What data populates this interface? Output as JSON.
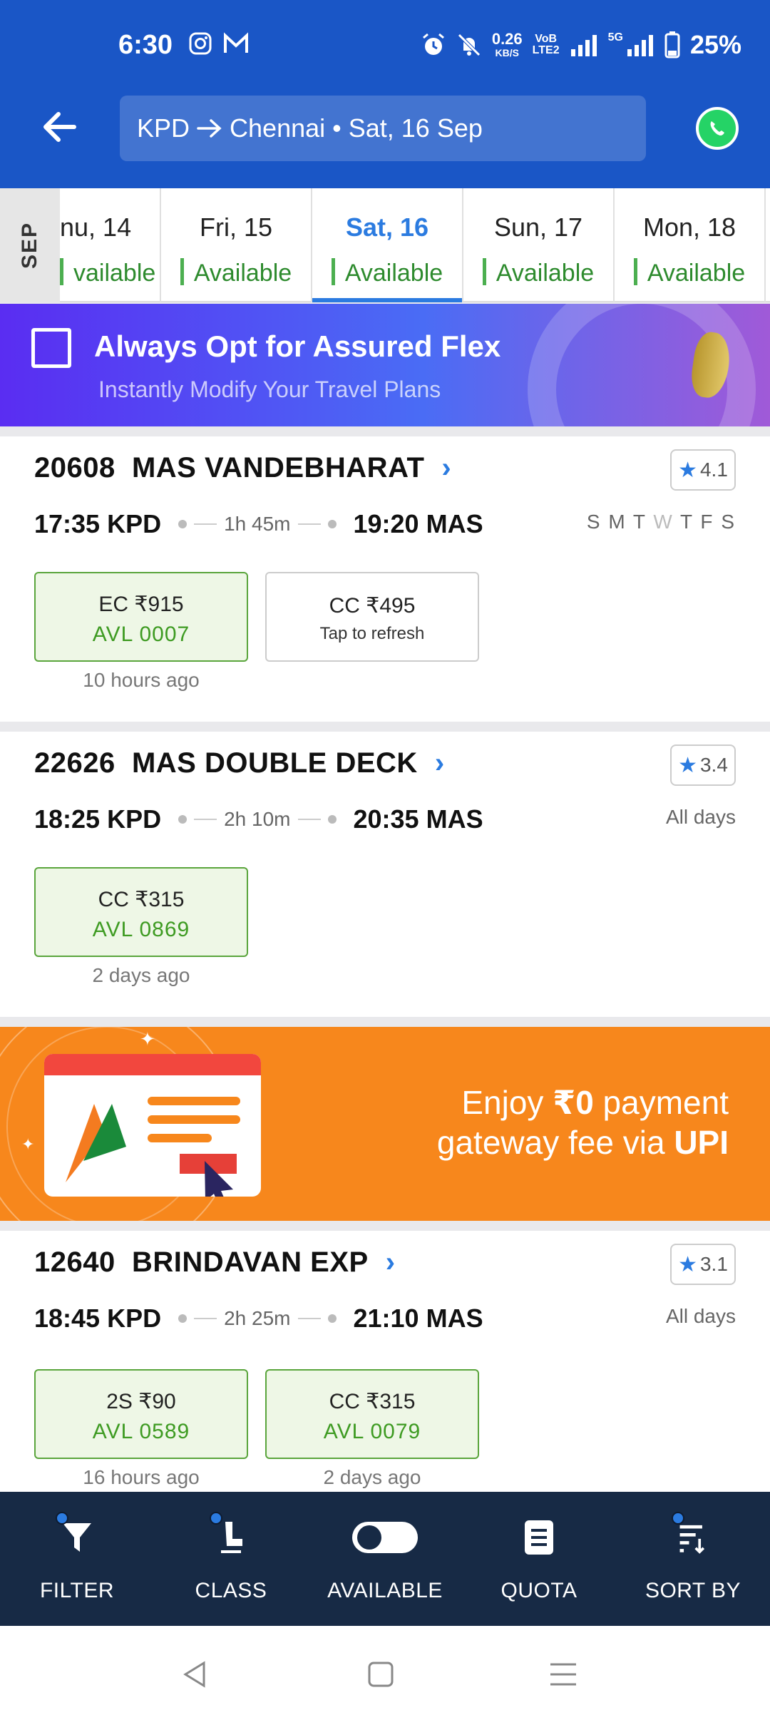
{
  "status": {
    "time": "6:30",
    "net_speed": "0.26",
    "net_unit": "KB/S",
    "volte_top": "VoB",
    "volte_bottom": "LTE2",
    "net_gen": "5G",
    "battery": "25%",
    "icons": [
      "instagram-icon",
      "gmail-icon",
      "alarm-icon",
      "mute-icon",
      "signal-icon",
      "battery-icon"
    ]
  },
  "header": {
    "route_from": "KPD",
    "route_rest": "Chennai • Sat, 16 Sep",
    "whatsapp_icon": "whatsapp-icon"
  },
  "date_bar": {
    "month": "SEP",
    "dates": [
      {
        "label": "nu, 14",
        "avail": "vailable"
      },
      {
        "label": "Fri, 15",
        "avail": "Available"
      },
      {
        "label": "Sat, 16",
        "avail": "Available"
      },
      {
        "label": "Sun, 17",
        "avail": "Available"
      },
      {
        "label": "Mon, 18",
        "avail": "Available"
      }
    ]
  },
  "flex_banner": {
    "title": "Always Opt for Assured Flex",
    "subtitle": "Instantly Modify Your Travel Plans"
  },
  "trains": [
    {
      "number": "20608",
      "name": "MAS VANDEBHARAT",
      "rating": "4.1",
      "dep": "17:35 KPD",
      "duration": "1h 45m",
      "arr": "19:20 MAS",
      "runs": [
        "S",
        "M",
        "T",
        "W",
        "T",
        "F",
        "S"
      ],
      "fares": [
        {
          "cls": "EC  ₹915",
          "status": "AVL 0007",
          "ago": "10 hours ago"
        },
        {
          "cls": "CC  ₹495",
          "status": "Tap to refresh",
          "ago": ""
        }
      ]
    },
    {
      "number": "22626",
      "name": "MAS DOUBLE DECK",
      "rating": "3.4",
      "dep": "18:25 KPD",
      "duration": "2h 10m",
      "arr": "20:35 MAS",
      "runs_text": "All days",
      "fares": [
        {
          "cls": "CC  ₹315",
          "status": "AVL 0869",
          "ago": "2 days ago"
        }
      ]
    },
    {
      "number": "12640",
      "name": "BRINDAVAN EXP",
      "rating": "3.1",
      "dep": "18:45 KPD",
      "duration": "2h 25m",
      "arr": "21:10 MAS",
      "runs_text": "All days",
      "fares": [
        {
          "cls": "2S  ₹90",
          "status": "AVL 0589",
          "ago": "16 hours ago"
        },
        {
          "cls": "CC  ₹315",
          "status": "AVL 0079",
          "ago": "2 days ago"
        }
      ]
    }
  ],
  "upi_banner": {
    "line1_pre": "Enjoy ",
    "line1_bold": "₹0",
    "line1_post": " payment",
    "line2_pre": "gateway fee via ",
    "line2_bold": "UPI"
  },
  "bottom_nav": {
    "filter": "FILTER",
    "class": "CLASS",
    "available": "AVAILABLE",
    "quota": "QUOTA",
    "sort_by": "SORT BY"
  },
  "colors": {
    "header": "#1a56c6",
    "accent": "#2b7be0",
    "available_green": "#3e9b22",
    "banner_orange": "#f7871c",
    "bottom_bar": "#172a45"
  }
}
